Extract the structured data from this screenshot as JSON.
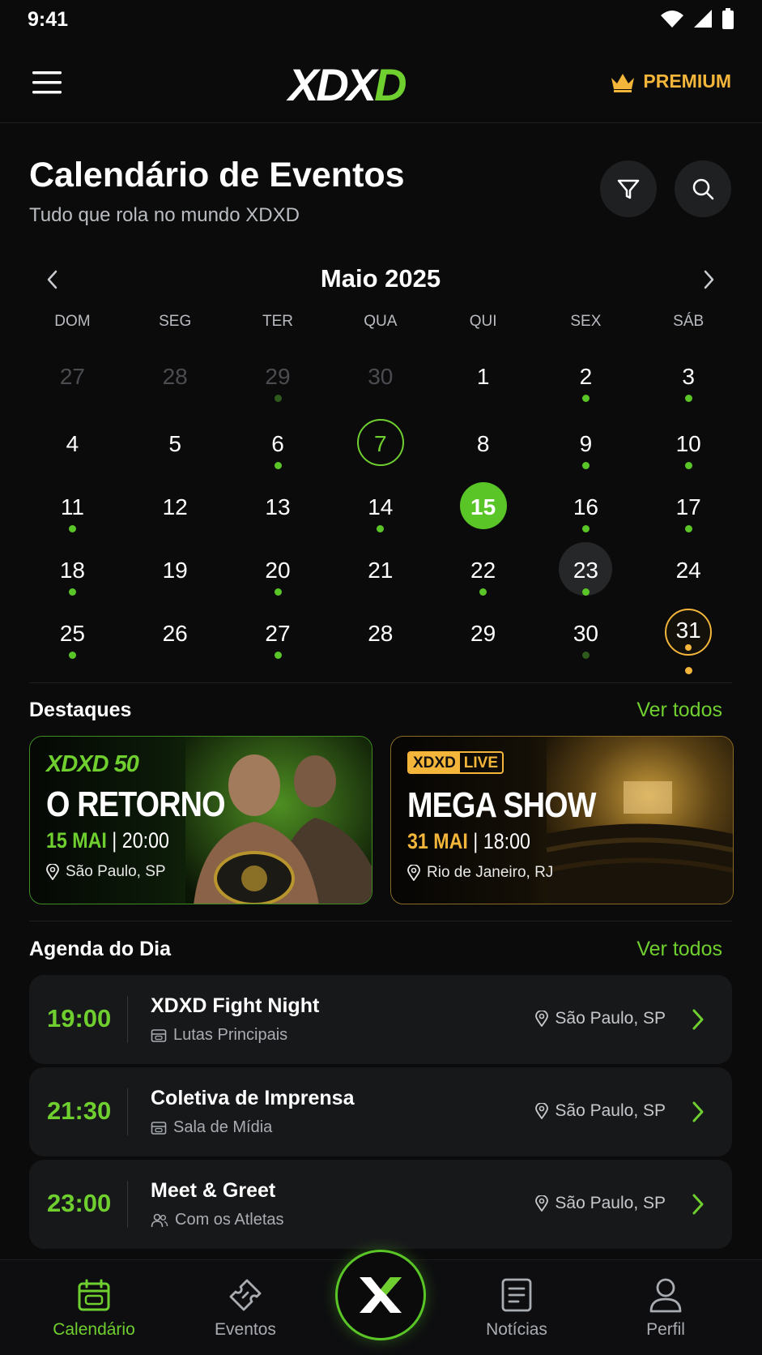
{
  "status_bar": {
    "time": "9:41"
  },
  "header": {
    "logo_left": "XDX",
    "logo_right": "D",
    "premium_label": "PREMIUM",
    "accent": "#6fcf2f",
    "gold": "#f4b63a"
  },
  "page": {
    "title": "Calendário de Eventos",
    "subtitle": "Tudo que rola no mundo XDXD"
  },
  "calendar": {
    "month_label": "Maio 2025",
    "weekdays": [
      "DOM",
      "SEG",
      "TER",
      "QUA",
      "QUI",
      "SEX",
      "SÁB"
    ],
    "selected_day": 7,
    "today_day": 15,
    "highlighted_day": 23,
    "special_day": 31,
    "days": [
      {
        "n": "27",
        "other": true,
        "dot": false
      },
      {
        "n": "28",
        "other": true,
        "dot": false
      },
      {
        "n": "29",
        "other": true,
        "dot": "dim"
      },
      {
        "n": "30",
        "other": true,
        "dot": false
      },
      {
        "n": "1",
        "dot": false
      },
      {
        "n": "2",
        "dot": true
      },
      {
        "n": "3",
        "dot": true
      },
      {
        "n": "4",
        "dot": false
      },
      {
        "n": "5",
        "dot": false
      },
      {
        "n": "6",
        "dot": true
      },
      {
        "n": "7",
        "dot": false,
        "state": "selected"
      },
      {
        "n": "8",
        "dot": false
      },
      {
        "n": "9",
        "dot": true
      },
      {
        "n": "10",
        "dot": true
      },
      {
        "n": "11",
        "dot": true
      },
      {
        "n": "12",
        "dot": false
      },
      {
        "n": "13",
        "dot": false
      },
      {
        "n": "14",
        "dot": true
      },
      {
        "n": "15",
        "dot": false,
        "state": "today"
      },
      {
        "n": "16",
        "dot": true
      },
      {
        "n": "17",
        "dot": true
      },
      {
        "n": "18",
        "dot": true
      },
      {
        "n": "19",
        "dot": false
      },
      {
        "n": "20",
        "dot": true
      },
      {
        "n": "21",
        "dot": false
      },
      {
        "n": "22",
        "dot": true
      },
      {
        "n": "23",
        "dot": true,
        "state": "hover"
      },
      {
        "n": "24",
        "dot": false
      },
      {
        "n": "25",
        "dot": true
      },
      {
        "n": "26",
        "dot": false
      },
      {
        "n": "27",
        "dot": true
      },
      {
        "n": "28",
        "dot": false
      },
      {
        "n": "29",
        "dot": false
      },
      {
        "n": "30",
        "dot": "dim"
      },
      {
        "n": "31",
        "dot": true,
        "state": "special"
      }
    ]
  },
  "highlights": {
    "title": "Destaques",
    "see_all": "Ver todos",
    "cards": [
      {
        "tag": "XDXD 50",
        "title": "O RETORNO",
        "date": "15 MAI",
        "separator": " | ",
        "time": "20:00",
        "location": "São Paulo, SP"
      },
      {
        "badge_left": "XDXD",
        "badge_right": "LIVE",
        "title": "MEGA SHOW",
        "date": "31 MAI",
        "separator": " | ",
        "time": "18:00",
        "location": "Rio de Janeiro, RJ"
      }
    ]
  },
  "agenda": {
    "title": "Agenda do Dia",
    "see_all": "Ver todos",
    "items": [
      {
        "time": "19:00",
        "name": "XDXD Fight Night",
        "sub": "Lutas Principais",
        "sub_icon": "ticket-icon",
        "location": "São Paulo, SP"
      },
      {
        "time": "21:30",
        "name": "Coletiva de Imprensa",
        "sub": "Sala de Mídia",
        "sub_icon": "ticket-icon",
        "location": "São Paulo, SP"
      },
      {
        "time": "23:00",
        "name": "Meet & Greet",
        "sub": "Com os Atletas",
        "sub_icon": "users-icon",
        "location": "São Paulo, SP"
      }
    ]
  },
  "bottom_nav": {
    "items": [
      {
        "label": "Calendário",
        "icon": "calendar-icon",
        "active": true
      },
      {
        "label": "Eventos",
        "icon": "ticket-icon"
      },
      {
        "label": "Notícias",
        "icon": "news-icon"
      },
      {
        "label": "Perfil",
        "icon": "user-icon"
      }
    ],
    "center_icon": "x-logo-icon"
  }
}
